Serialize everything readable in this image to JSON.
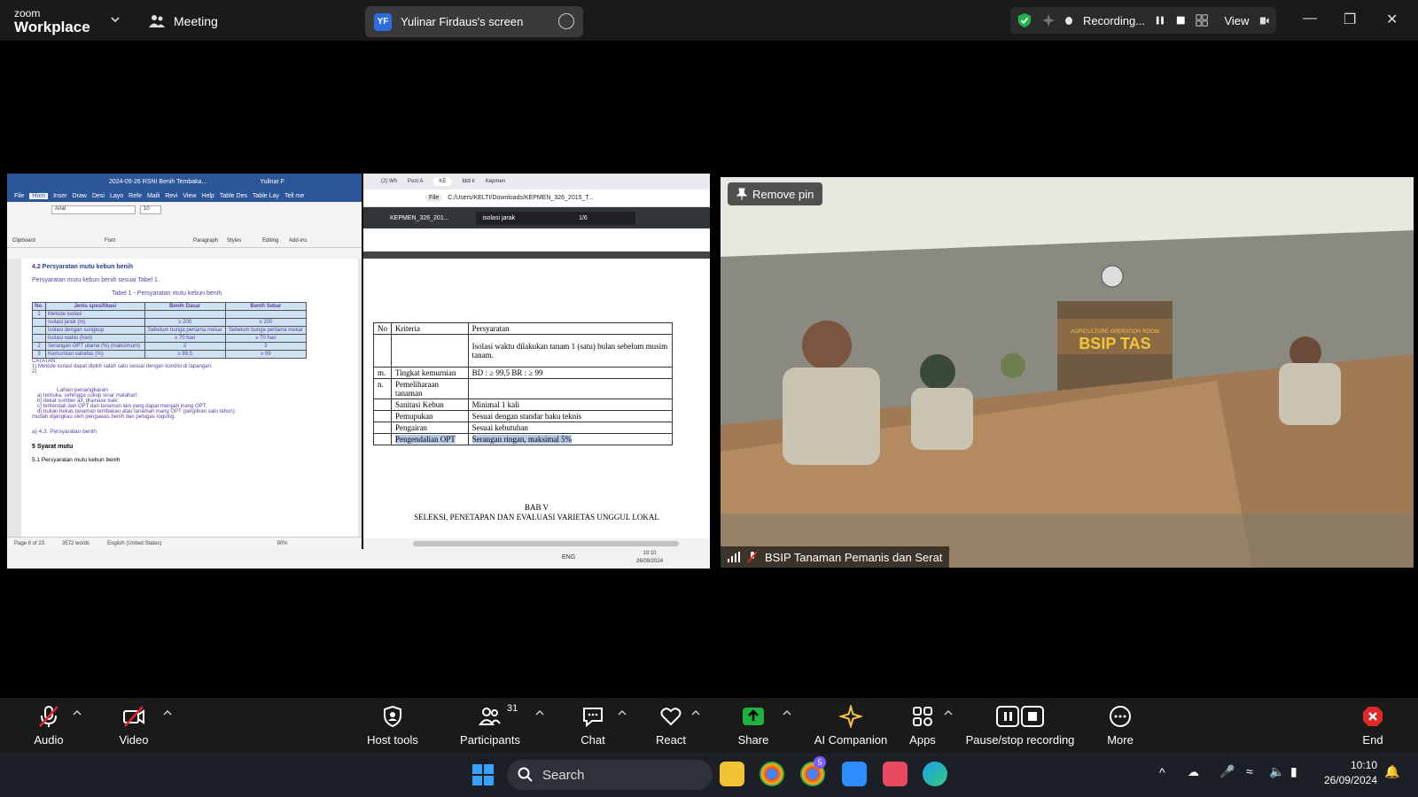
{
  "topbar": {
    "logo_small": "zoom",
    "logo_big": "Workplace",
    "meeting_label": "Meeting",
    "share_initials": "YF",
    "share_title": "Yulinar Firdaus's screen",
    "recording_label": "Recording...",
    "view_label": "View"
  },
  "word": {
    "title": "2024-09-26 RSNI Benih Tembaka...",
    "user": "Yulinar F",
    "tabs": [
      "File",
      "Hom",
      "Inser",
      "Draw",
      "Desi",
      "Layo",
      "Refe",
      "Maili",
      "Revi",
      "View",
      "Help",
      "Table Des",
      "Table Lay",
      "Tell me"
    ],
    "font_name": "Arial",
    "font_size": "10",
    "groups": [
      "Clipboard",
      "Font",
      "Paragraph",
      "Styles",
      "Editing",
      "Add-ins"
    ],
    "heading": "4.2 Persyaratan mutu kebun benih",
    "intro": "Persyaratan mutu kebun benih sesuai Tabel 1.",
    "table_title": "Tabel 1 - Persyaratan mutu kebun benih",
    "table_headers": [
      "No.",
      "Jenis spesifikasi",
      "Benih Dasar",
      "Benih Sebar"
    ],
    "table_rows": [
      [
        "1",
        "Metode isolasi",
        "",
        ""
      ],
      [
        "",
        "Isolasi jarak (m)",
        "≥ 200",
        "≥ 200"
      ],
      [
        "",
        "Isolasi dengan sungkup",
        "Sebelum bunga pertama mekar",
        "Sebelum bunga pertama mekar"
      ],
      [
        "",
        "Isolasi waktu (hari)",
        "≥ 70 hari",
        "≥ 70 hari"
      ],
      [
        "2",
        "Serangan OPT utama (%) (maksimum)",
        "2",
        "3"
      ],
      [
        "3",
        "Kemurnian varietas (%)",
        "≥ 99,5",
        "≥ 99"
      ]
    ],
    "catatan": "CATATAN:",
    "note1": "1)  Metode isolasi dapat dipilih salah satu sesuai dengan kondisi di lapangan.",
    "note2": "2)",
    "lahan": "Lahan penangkaran",
    "lahan_a": "a)   terbuka, sehingga cukup sinar matahari;",
    "lahan_b": "b)   dekat sumber air, drainase baik;",
    "lahan_c": "c)   terkendali dari OPT dan tanaman lain yang dapat menjadi inang OPT;",
    "lahan_d": "d)   bukan bekas tanaman tembakau atau tanaman inang OPT (pergiliran satu tahun).",
    "lahan_e": "mudah dijangkau oleh pengawas benih dan petugas roguing.",
    "sub43": "a)        4.3. Persyaratan benih",
    "syarat": "5     Syarat mutu",
    "s51": "5.1 Persyaratan mutu kebun benih",
    "status_page": "Page 8 of 23",
    "status_words": "3572 words",
    "status_lang": "English (United States)",
    "zoom": "90%"
  },
  "pdf": {
    "tabs": [
      "(2) Wh",
      "Post A",
      "KE",
      "Iddi k",
      "Kepmen"
    ],
    "url_label": "File",
    "url": "C:/Users/KELTI/Downloads/KEPMEN_326_2015_T...",
    "doc_name": "KEPMEN_326_201...",
    "page_box": "2",
    "search_query": "isolasi jarak",
    "search_count": "1/6",
    "table_headers": [
      "No",
      "Kriteria",
      "Persyaratan"
    ],
    "rows": [
      [
        "",
        "",
        "Isolasi waktu dilakukan tanam 1 (satu) bulan sebelum musim tanam."
      ],
      [
        "m.",
        "Tingkat kemurnian",
        "BD : ≥ 99,5 BR : ≥ 99"
      ],
      [
        "n.",
        "Pemeliharaan tanaman",
        ""
      ],
      [
        "",
        "Sanitasi Kebun",
        "Minimal 1 kali"
      ],
      [
        "",
        "Pemupukan",
        "Sesuai dengan standar baku teknis"
      ],
      [
        "",
        "Pengairan",
        "Sesuai kebutuhan"
      ],
      [
        "",
        "Pengendalian OPT",
        "Serangan ringan, maksimal 5%"
      ]
    ],
    "bab": "BAB V",
    "bab_title": "SELEKSI, PENETAPAN DAN EVALUASI VARIETAS UNGGUL LOKAL"
  },
  "inner_taskbar": {
    "lang": "ENG",
    "time": "10:10",
    "date": "26/09/2024"
  },
  "camera": {
    "remove_pin": "Remove pin",
    "name": "BSIP Tanaman Pemanis dan Serat",
    "sign": "BSIP TAS",
    "sign_small": "AGRICULTURE OPERATION ROOM"
  },
  "toolbar": {
    "audio": "Audio",
    "video": "Video",
    "host_tools": "Host tools",
    "participants": "Participants",
    "participants_count": "31",
    "chat": "Chat",
    "react": "React",
    "share": "Share",
    "ai_companion": "AI Companion",
    "apps": "Apps",
    "pause_stop": "Pause/stop recording",
    "more": "More",
    "end": "End"
  },
  "taskbar": {
    "search": "Search",
    "time": "10:10",
    "date": "26/09/2024",
    "chrome_badge": "5"
  },
  "colors": {
    "share_green": "#1fb141",
    "end_red": "#e02828",
    "accent": "#2d6cdf"
  }
}
